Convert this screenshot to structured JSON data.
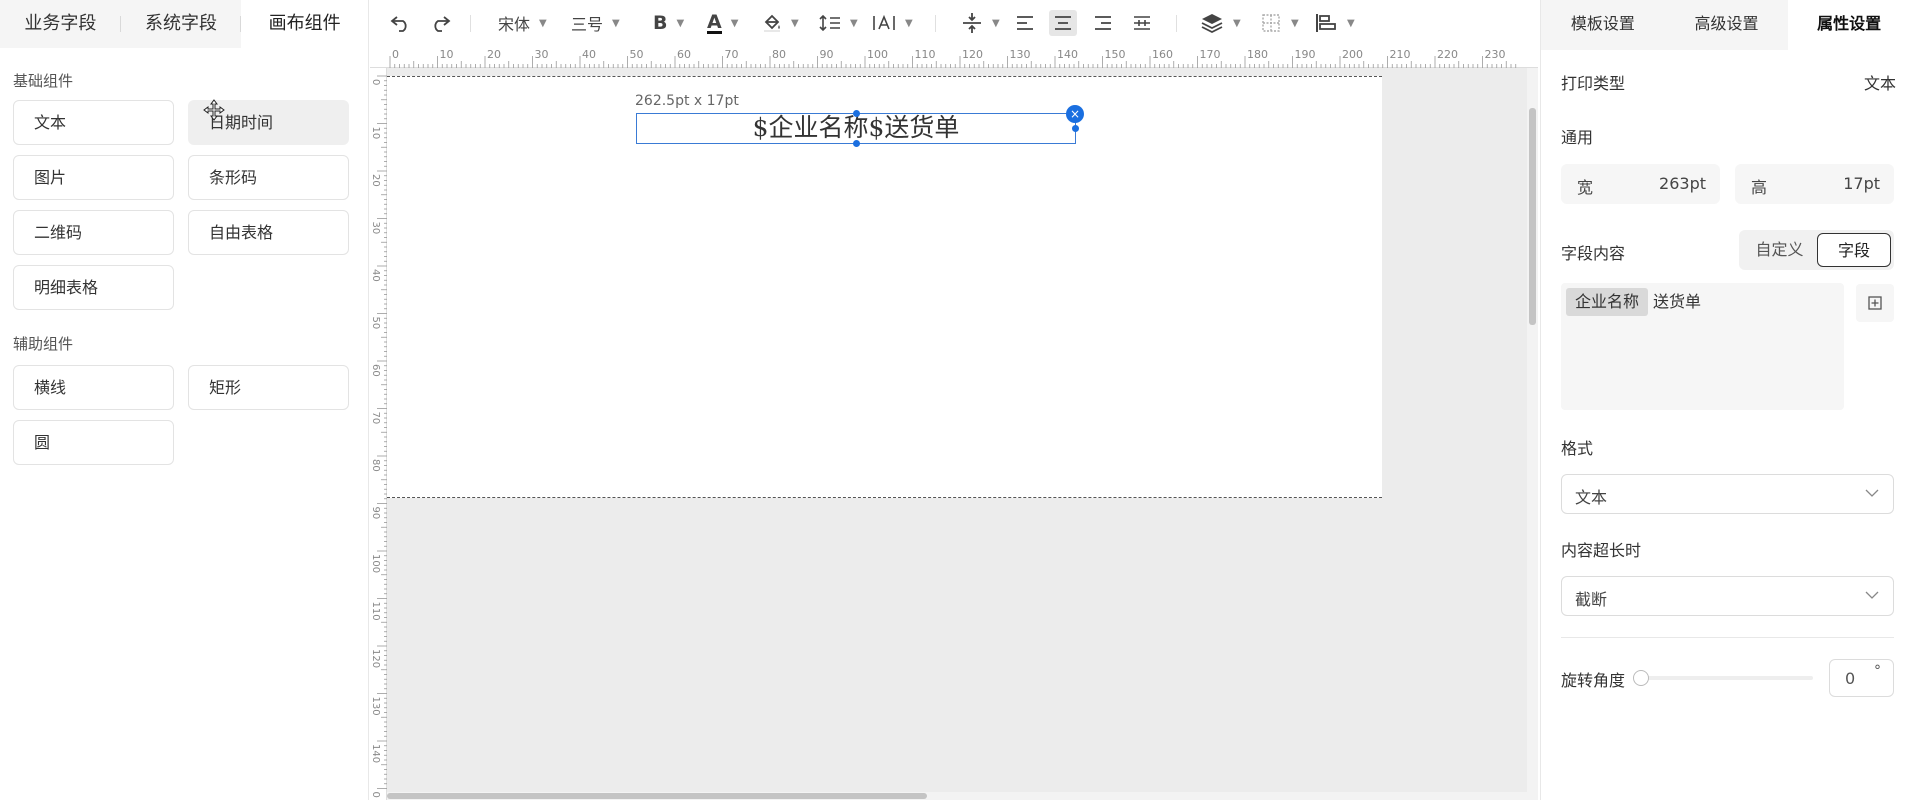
{
  "left_panel": {
    "tabs": [
      {
        "label": "业务字段"
      },
      {
        "label": "系统字段"
      },
      {
        "label": "画布组件"
      }
    ],
    "basic_title": "基础组件",
    "basic_items": [
      {
        "label": "文本"
      },
      {
        "label": "日期时间"
      },
      {
        "label": "图片"
      },
      {
        "label": "条形码"
      },
      {
        "label": "二维码"
      },
      {
        "label": "自由表格"
      },
      {
        "label": "明细表格"
      }
    ],
    "aux_title": "辅助组件",
    "aux_items": [
      {
        "label": "横线"
      },
      {
        "label": "矩形"
      },
      {
        "label": "圆"
      }
    ]
  },
  "toolbar": {
    "font_family": "宋体",
    "font_size": "三号",
    "bold_label": "B",
    "font_color_label": "A",
    "font_color": "#111111"
  },
  "ruler": {
    "top_labels": [
      "0",
      "10",
      "20",
      "30",
      "40",
      "50",
      "60",
      "70",
      "80",
      "90",
      "100",
      "110",
      "120",
      "130",
      "140",
      "150",
      "160",
      "170",
      "180",
      "190",
      "200",
      "210",
      "220",
      "230"
    ],
    "left_labels": [
      "0",
      "10",
      "20",
      "30",
      "40",
      "50",
      "60",
      "70",
      "80",
      "90",
      "100",
      "110",
      "120",
      "130",
      "140",
      "0"
    ]
  },
  "canvas": {
    "size_label": "262.5pt x 17pt",
    "selected_text": "$企业名称$送货单",
    "close_icon_glyph": "×"
  },
  "right_panel": {
    "tabs": [
      {
        "label": "模板设置"
      },
      {
        "label": "高级设置"
      },
      {
        "label": "属性设置"
      }
    ],
    "print_type_label": "打印类型",
    "print_type_value": "文本",
    "general_label": "通用",
    "width_label": "宽",
    "width_value": "263pt",
    "height_label": "高",
    "height_value": "17pt",
    "field_content_label": "字段内容",
    "mode_custom": "自定义",
    "mode_field": "字段",
    "field_chip": "企业名称",
    "field_tail": "送货单",
    "format_label": "格式",
    "format_value": "文本",
    "overflow_label": "内容超长时",
    "overflow_value": "截断",
    "rotation_label": "旋转角度",
    "rotation_value": "0",
    "rotation_unit": "°"
  },
  "colors": {
    "accent": "#1a6fe0",
    "selection_border": "#3a7bd5"
  }
}
